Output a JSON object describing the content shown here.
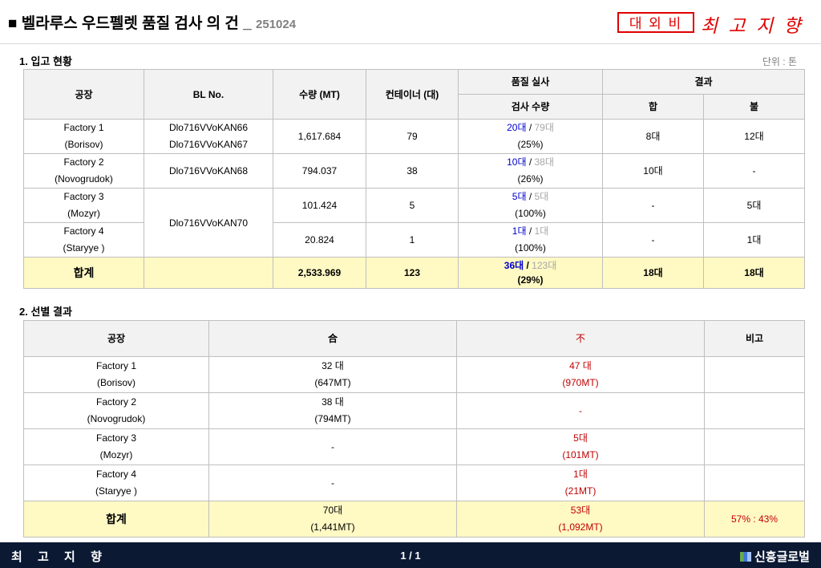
{
  "header": {
    "bullet": "■",
    "title": "벨라루스 우드펠렛 품질 검사 의 건 _",
    "date": "251024",
    "confidential": "대 외 비",
    "slogan": "최 고 지 향"
  },
  "section1": {
    "title": "1. 입고 현황",
    "unit": "단위 : 톤",
    "headers": {
      "factory": "공장",
      "bl": "BL No.",
      "qty": "수량 (MT)",
      "container": "컨테이너 (대)",
      "inspection": "품질 실사",
      "inspection_qty": "검사 수량",
      "result": "결과",
      "pass": "합",
      "fail": "불"
    },
    "rows": [
      {
        "factory1": "Factory 1",
        "factory2": "(Borisov)",
        "bl1": "Dlo716VVoKAN66",
        "bl2": "Dlo716VVoKAN67",
        "qty": "1,617.684",
        "container": "79",
        "inspected": "20대",
        "sep": " / ",
        "total": "79대",
        "pct": "(25%)",
        "pass": "8대",
        "fail": "12대"
      },
      {
        "factory1": "Factory 2",
        "factory2": "(Novogrudok)",
        "bl1": "Dlo716VVoKAN68",
        "qty": "794.037",
        "container": "38",
        "inspected": "10대",
        "sep": " / ",
        "total": "38대",
        "pct": "(26%)",
        "pass": "10대",
        "fail": "-"
      },
      {
        "factory1": "Factory 3",
        "factory2": "(Mozyr)",
        "bl1": "Dlo716VVoKAN70",
        "qty": "101.424",
        "container": "5",
        "inspected": "5대",
        "sep": " / ",
        "total": "5대",
        "pct": "(100%)",
        "pass": "-",
        "fail": "5대"
      },
      {
        "factory1": "Factory 4",
        "factory2": "(Staryye )",
        "qty": "20.824",
        "container": "1",
        "inspected": "1대",
        "sep": " / ",
        "total": "1대",
        "pct": "(100%)",
        "pass": "-",
        "fail": "1대"
      }
    ],
    "total": {
      "label": "합계",
      "qty": "2,533.969",
      "container": "123",
      "inspected": "36대",
      "sep": " / ",
      "total": "123대",
      "pct": "(29%)",
      "pass": "18대",
      "fail": "18대"
    }
  },
  "section2": {
    "title": "2. 선별 결과",
    "headers": {
      "factory": "공장",
      "pass": "合",
      "fail": "不",
      "remark": "비고"
    },
    "rows": [
      {
        "factory1": "Factory 1",
        "factory2": "(Borisov)",
        "pass1": "32 대",
        "pass2": "(647MT)",
        "fail1": "47 대",
        "fail2": "(970MT)",
        "remark": ""
      },
      {
        "factory1": "Factory 2",
        "factory2": "(Novogrudok)",
        "pass1": "38 대",
        "pass2": "(794MT)",
        "fail1": "-",
        "fail2": "",
        "remark": ""
      },
      {
        "factory1": "Factory 3",
        "factory2": "(Mozyr)",
        "pass1": "-",
        "pass2": "",
        "fail1": "5대",
        "fail2": "(101MT)",
        "remark": ""
      },
      {
        "factory1": "Factory 4",
        "factory2": "(Staryye )",
        "pass1": "-",
        "pass2": "",
        "fail1": "1대",
        "fail2": "(21MT)",
        "remark": ""
      }
    ],
    "total": {
      "label": "합계",
      "pass1": "70대",
      "pass2": "(1,441MT)",
      "fail1": "53대",
      "fail2": "(1,092MT)",
      "remark": "57% : 43%"
    }
  },
  "footer": {
    "slogan": "최 고 지 향",
    "page": "1 / 1",
    "company": "신흥글로벌"
  }
}
